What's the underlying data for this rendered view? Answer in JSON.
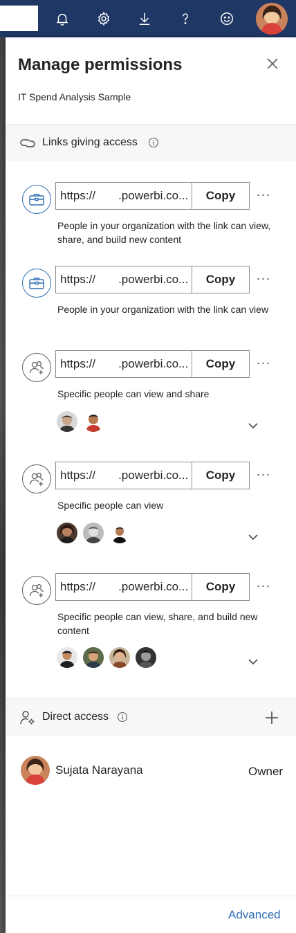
{
  "topbar": {
    "icons": [
      "bell-icon",
      "gear-icon",
      "download-icon",
      "help-icon",
      "smiley-icon"
    ],
    "bg_color": "#1f3765"
  },
  "panel": {
    "title": "Manage permissions",
    "subtitle": "IT Spend Analysis Sample"
  },
  "links_section": {
    "label": "Links giving access",
    "items": [
      {
        "url": "https://       .powerbi.co...",
        "copy_label": "Copy",
        "more_label": "···",
        "description": "People in your organization with the link can view, share, and build new content",
        "type": "organization"
      },
      {
        "url": "https://       .powerbi.co...",
        "copy_label": "Copy",
        "more_label": "···",
        "description": "People in your organization with the link can view",
        "type": "organization"
      },
      {
        "url": "https://       .powerbi.co...",
        "copy_label": "Copy",
        "more_label": "···",
        "description": "Specific people can view and share",
        "type": "specific",
        "avatar_count": 2
      },
      {
        "url": "https://       .powerbi.co...",
        "copy_label": "Copy",
        "more_label": "···",
        "description": "Specific people can view",
        "type": "specific",
        "avatar_count": 3
      },
      {
        "url": "https://       .powerbi.co...",
        "copy_label": "Copy",
        "more_label": "···",
        "description": "Specific people can view, share, and build new content",
        "type": "specific",
        "avatar_count": 4
      }
    ]
  },
  "direct_section": {
    "label": "Direct access",
    "users": [
      {
        "name": "Sujata Narayana",
        "role": "Owner"
      }
    ]
  },
  "footer": {
    "advanced_label": "Advanced"
  },
  "colors": {
    "accent": "#2f6fb5",
    "text": "#252423"
  }
}
